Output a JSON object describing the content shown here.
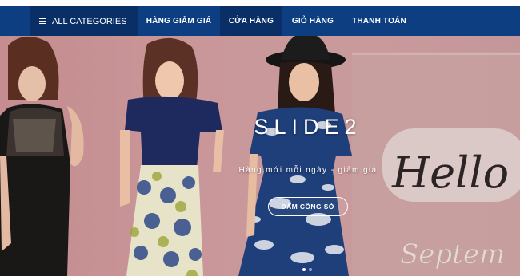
{
  "nav": {
    "categories_label": "ALL CATEGORIES",
    "items": [
      {
        "label": "HÀNG GIẢM GIÁ",
        "active": false
      },
      {
        "label": "CỬA HÀNG",
        "active": true
      },
      {
        "label": "GIỎ HÀNG",
        "active": false
      },
      {
        "label": "THANH TOÁN",
        "active": false
      }
    ]
  },
  "slider": {
    "title": "SLIDE2",
    "subtitle": "Hàng mới mỗi ngày - giảm giá",
    "button_label": "ĐẦM CÔNG SỞ",
    "background_text_1": "Hello",
    "background_text_2": "Septem",
    "dots_total": 2,
    "dots_active_index": 0
  },
  "colors": {
    "nav_bg": "#0d3e82",
    "nav_active_bg": "#0a2f66",
    "slide_bg": "#c99598"
  }
}
